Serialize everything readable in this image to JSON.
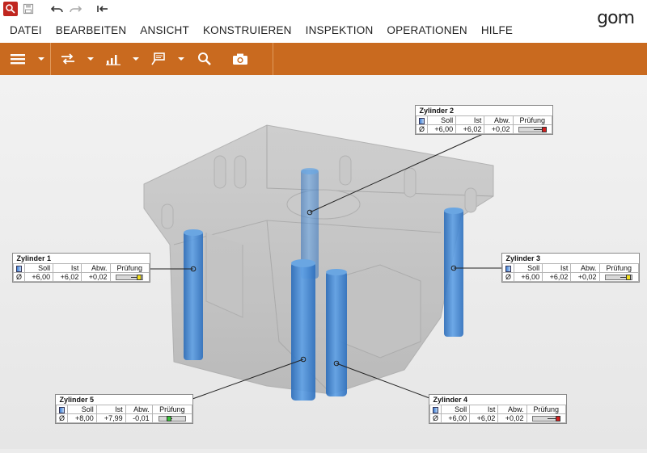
{
  "app": {
    "logo": "gom"
  },
  "quick_access": [
    {
      "icon": "search-icon"
    },
    {
      "icon": "save-icon"
    },
    {
      "icon": "undo-icon"
    },
    {
      "icon": "redo-icon"
    },
    {
      "icon": "back-arrow-icon"
    }
  ],
  "menu": [
    "DATEI",
    "BEARBEITEN",
    "ANSICHT",
    "KONSTRUIEREN",
    "INSPEKTION",
    "OPERATIONEN",
    "HILFE"
  ],
  "toolbar": [
    {
      "icon": "hamburger-menu-icon"
    },
    {
      "icon": "align-arrows-icon"
    },
    {
      "icon": "bar-chart-icon"
    },
    {
      "icon": "label-flag-icon"
    },
    {
      "icon": "magnifier-icon"
    },
    {
      "icon": "camera-icon"
    }
  ],
  "colors": {
    "toolbar_orange": "#c96a1f",
    "cylinder_blue": "#3f86d0",
    "status_red": "#d42020",
    "status_yellow": "#f2df1c",
    "status_green": "#3ac23a"
  },
  "label_headers": {
    "soll": "Soll",
    "ist": "Ist",
    "abw": "Abw.",
    "pruefung": "Prüfung",
    "symbol": "Ø"
  },
  "labels": [
    {
      "id": "z2",
      "title": "Zylinder 2",
      "soll": "+6,00",
      "ist": "+6,02",
      "abw": "+0,02",
      "status": "red"
    },
    {
      "id": "z1",
      "title": "Zylinder 1",
      "soll": "+6,00",
      "ist": "+6,02",
      "abw": "+0,02",
      "status": "yellow"
    },
    {
      "id": "z3",
      "title": "Zylinder 3",
      "soll": "+6,00",
      "ist": "+6,02",
      "abw": "+0,02",
      "status": "yellow"
    },
    {
      "id": "z5",
      "title": "Zylinder 5",
      "soll": "+8,00",
      "ist": "+7,99",
      "abw": "-0,01",
      "status": "green"
    },
    {
      "id": "z4",
      "title": "Zylinder 4",
      "soll": "+6,00",
      "ist": "+6,02",
      "abw": "+0,02",
      "status": "red"
    }
  ]
}
